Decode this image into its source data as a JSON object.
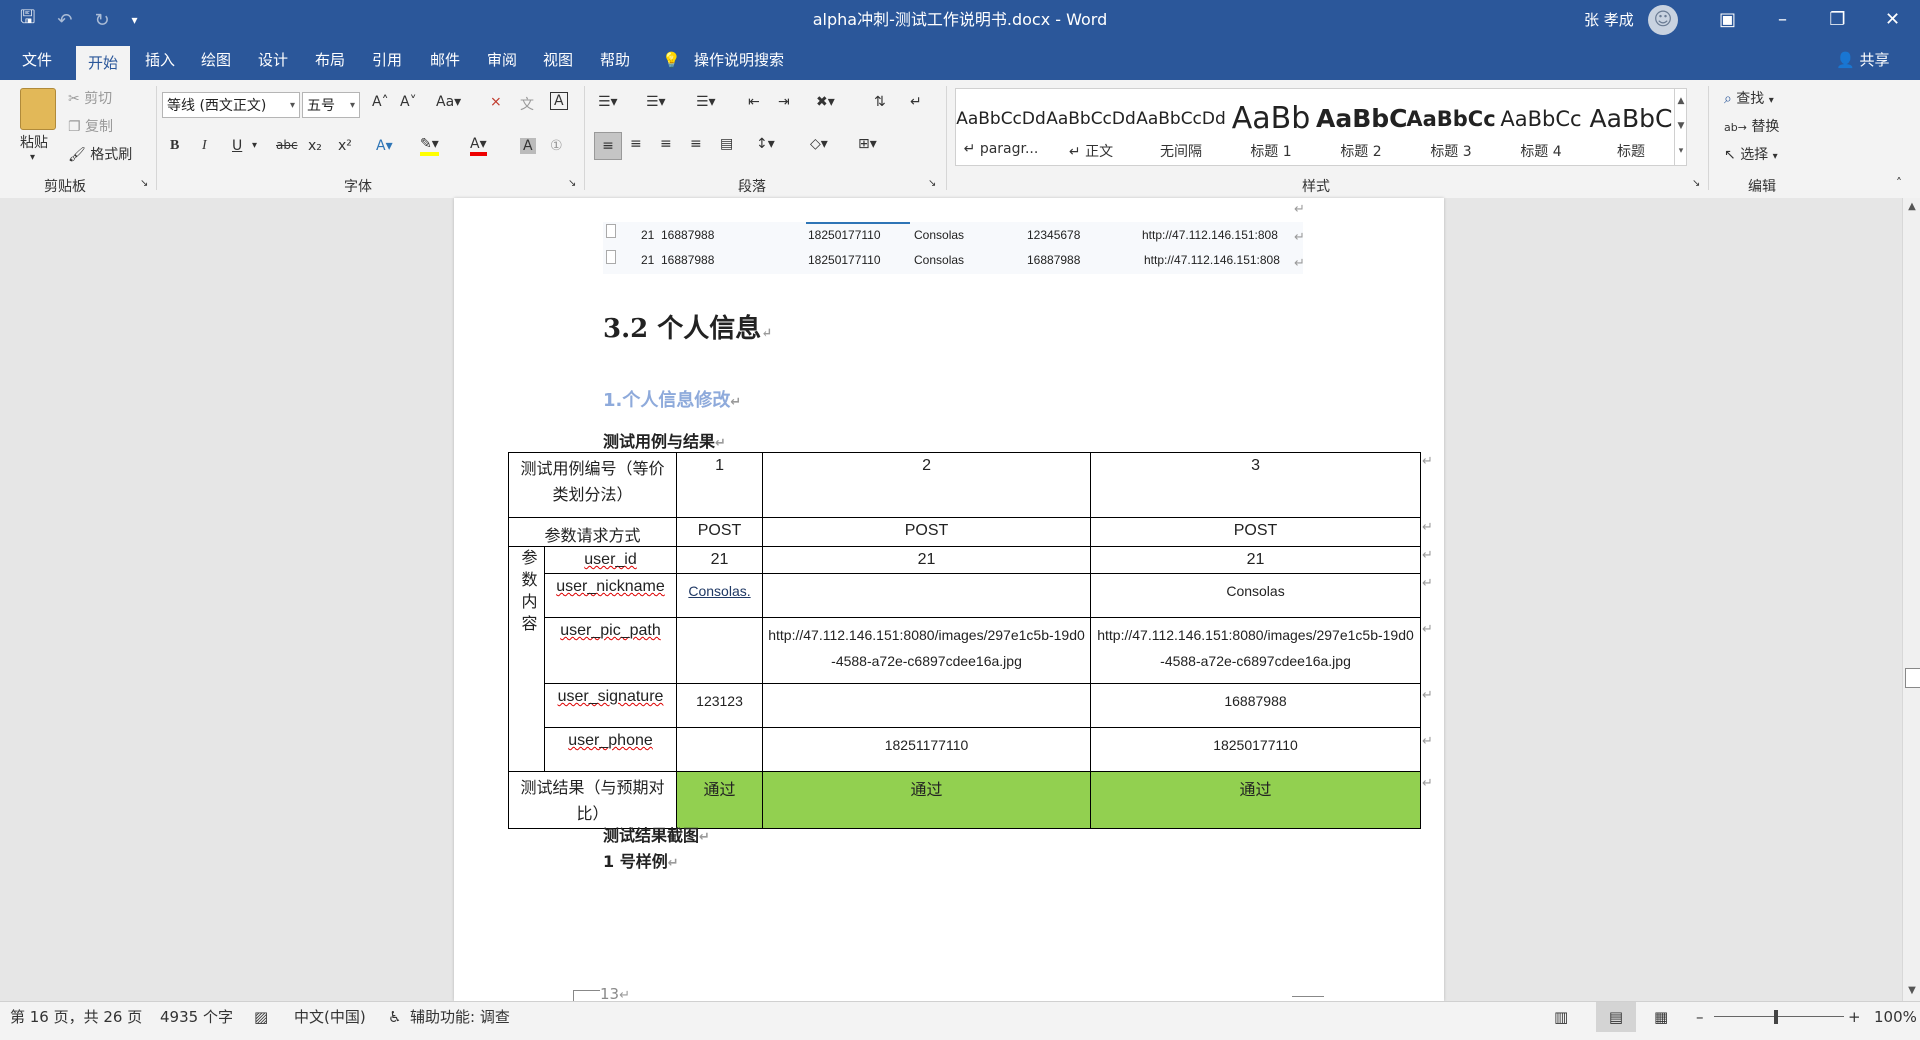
{
  "title_bar": {
    "document_title": "alpha冲刺-测试工作说明书.docx  -  Word",
    "user_name": "张 孝成",
    "icons": [
      "save-icon",
      "undo-icon",
      "redo-icon",
      "customize-icon"
    ]
  },
  "menu": {
    "tabs": [
      {
        "label": "文件"
      },
      {
        "label": "开始"
      },
      {
        "label": "插入"
      },
      {
        "label": "绘图"
      },
      {
        "label": "设计"
      },
      {
        "label": "布局"
      },
      {
        "label": "引用"
      },
      {
        "label": "邮件"
      },
      {
        "label": "审阅"
      },
      {
        "label": "视图"
      },
      {
        "label": "帮助"
      }
    ],
    "tell_me": "操作说明搜索",
    "share": "共享"
  },
  "ribbon": {
    "clipboard": {
      "paste": "粘贴",
      "cut": "剪切",
      "copy": "复制",
      "format_painter": "格式刷",
      "group": "剪贴板"
    },
    "font": {
      "font_name": "等线 (西文正文)",
      "font_size": "五号",
      "group": "字体"
    },
    "paragraph": {
      "group": "段落"
    },
    "styles": {
      "group": "样式",
      "items": [
        {
          "sample": "AaBbCcDd",
          "name": "↵ paragr..."
        },
        {
          "sample": "AaBbCcDd",
          "name": "↵ 正文"
        },
        {
          "sample": "AaBbCcDd",
          "name": "无间隔"
        },
        {
          "sample": "AaBb",
          "name": "标题 1"
        },
        {
          "sample": "AaBbC",
          "name": "标题 2"
        },
        {
          "sample": "AaBbCc",
          "name": "标题 3"
        },
        {
          "sample": "AaBbCc",
          "name": "标题 4"
        },
        {
          "sample": "AaBbC",
          "name": "标题"
        }
      ]
    },
    "editing": {
      "find": "查找",
      "replace": "替换",
      "select": "选择",
      "group": "编辑"
    }
  },
  "document": {
    "screenshot_rows": [
      [
        "21",
        "16887988",
        "18250177110",
        "Consolas",
        "12345678",
        "http://47.112.146.151:808"
      ],
      [
        "21",
        "16887988",
        "18250177110",
        "Consolas",
        "16887988",
        "http://47.112.146.151:808"
      ]
    ],
    "heading2": "3.2  个人信息",
    "heading3": "1.个人信息修改",
    "para_cases": "测试用例与结果",
    "table": {
      "header_label": "测试用例编号（等价类划分法）",
      "case_ids": [
        "1",
        "2",
        "3"
      ],
      "method_label": "参数请求方式",
      "methods": [
        "POST",
        "POST",
        "POST"
      ],
      "param_group_label": "参数内容",
      "params": [
        {
          "name": "user_id",
          "values": [
            "21",
            "21",
            "21"
          ]
        },
        {
          "name": "user_nickname",
          "values": [
            "Consolas.",
            "",
            "Consolas"
          ]
        },
        {
          "name": "user_pic_path",
          "values": [
            "",
            "http://47.112.146.151:8080/images/297e1c5b-19d0-4588-a72e-c6897cdee16a.jpg",
            "http://47.112.146.151:8080/images/297e1c5b-19d0-4588-a72e-c6897cdee16a.jpg"
          ]
        },
        {
          "name": "user_signature",
          "values": [
            "123123",
            "",
            "16887988"
          ]
        },
        {
          "name": "user_phone",
          "values": [
            "",
            "18251177110",
            "18250177110"
          ]
        }
      ],
      "result_label": "测试结果（与预期对比）",
      "results": [
        "通过",
        "通过",
        "通过"
      ],
      "pass_color": "#92d050"
    },
    "para_screenshot": "测试结果截图",
    "para_sample": "1 号样例",
    "page_number": "13"
  },
  "status_bar": {
    "page_info": "第 16 页，共 26 页",
    "word_count": "4935 个字",
    "language": "中文(中国)",
    "accessibility": "辅助功能: 调查",
    "zoom": "100%"
  },
  "colors": {
    "accent": "#2b579a",
    "heading3": "#8eaadb"
  }
}
